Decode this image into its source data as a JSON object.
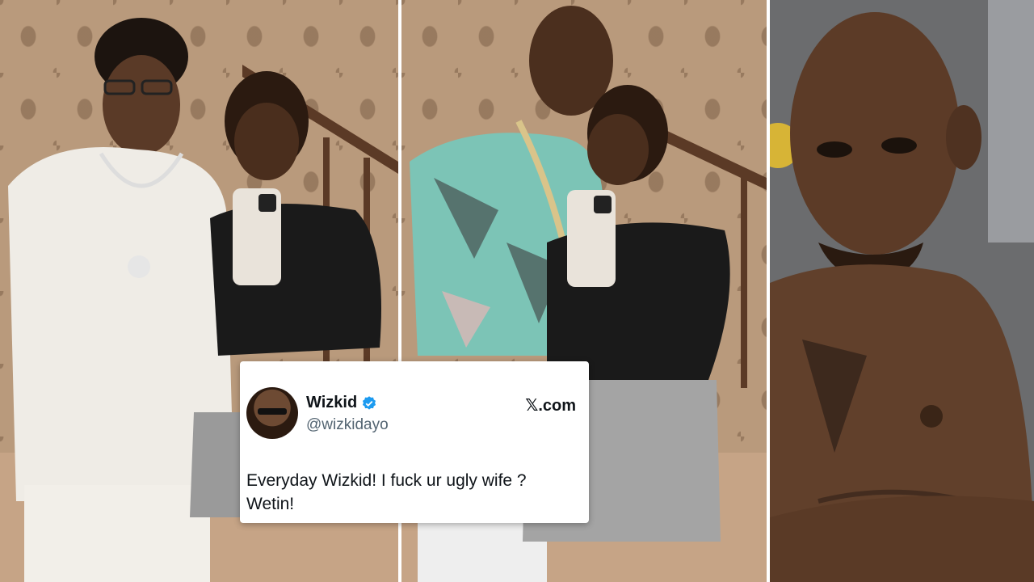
{
  "image": {
    "panels": [
      "couple-selfie-left",
      "couple-selfie-center",
      "shirtless-man-right"
    ]
  },
  "tweet": {
    "display_name": "Wizkid",
    "handle": "@wizkidayo",
    "source_label": ".com",
    "source_icon": "x-logo-icon",
    "text": "Everyday Wizkid! I fuck ur ugly wife ? Wetin!",
    "verified_color": "#1d9bf0"
  }
}
